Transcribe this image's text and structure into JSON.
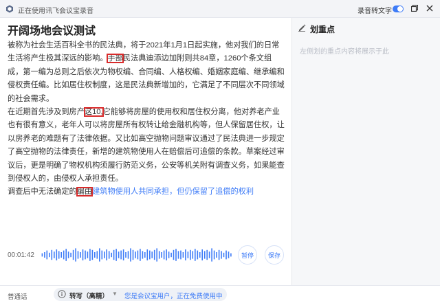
{
  "titlebar": {
    "title": "正在使用讯飞会议宝录音",
    "toggle_label": "录音转文字",
    "toggle_on": true
  },
  "document": {
    "title": "开阔场地会议测试",
    "paragraphs": [
      {
        "segments": [
          {
            "text": "被称为社会生活百科全书的民法典，将于2021年1月1日起实施，他对我们的日常生活将产生极其深远的影响。",
            "highlight": false
          },
          {
            "text": "手部",
            "highlight": true
          },
          {
            "text": "民法典迪添边加附则共84章，1260个条文组成，第一编为总则之后依次为物权编、合同编、人格权编、婚姻家庭编、继承编和侵权责任编。比如居住权制度，这是民法典新增加的，它满足了不同层次不同领域的社会需求。",
            "highlight": false
          }
        ]
      },
      {
        "segments": [
          {
            "text": "在近期首先涉及到房产",
            "highlight": false
          },
          {
            "text": "这10,",
            "highlight": true
          },
          {
            "text": "它能够将房屋的使用权和居住权分离，他对养老产业也有很有意义，老年人可以将房屋所有权转让给金融机构等，但人保留居住权，让以房养老的难题有了法律依据。又比如高空抛物问题审议通过了民法典进一步规定了高空抛物的法律责任，新增的建筑物使用人在赔偿后可追偿的条款。草案经过审议后，更是明确了物权机构须履行防范义务，公安等机关附有调查义务，如果能查到侵权人的，由侵权人承担责任。",
            "highlight": false
          }
        ]
      },
      {
        "segments": [
          {
            "text": "调查后中无法确定的",
            "highlight": false
          },
          {
            "text": "编由",
            "highlight": true
          },
          {
            "text": "建筑物使用人共同承担，但仍保留了追偿的权利",
            "highlight": false,
            "live": true
          }
        ]
      }
    ]
  },
  "notes_panel": {
    "title": "划重点",
    "hint": "左侧划的重点内容将展示于此"
  },
  "recording": {
    "elapsed": "00:01:42",
    "pause_label": "暂停",
    "save_label": "保存",
    "wave_levels": [
      3,
      5,
      8,
      4,
      9,
      6,
      10,
      7,
      5,
      8,
      11,
      6,
      4,
      9,
      12,
      7,
      5,
      10,
      8,
      6,
      11,
      9,
      5,
      7,
      12,
      8,
      6,
      10,
      7,
      4,
      9,
      11,
      6,
      8,
      10,
      5,
      7,
      12,
      9,
      6,
      8,
      11,
      7,
      5,
      10,
      8,
      6,
      9,
      12,
      7,
      5,
      8,
      10,
      6,
      4,
      9,
      11,
      7,
      8,
      5,
      10,
      6,
      9,
      7,
      11,
      8,
      5,
      10,
      7,
      9,
      6,
      12,
      8,
      5,
      9,
      7,
      4,
      8,
      6,
      3
    ]
  },
  "footer": {
    "mode": "普通话",
    "transcribe_mode": "转写（高精）",
    "user_note": "您是会议宝用户，正在免费使用中"
  },
  "colors": {
    "accent": "#3d7bf7",
    "highlight_box": "#d92b2b"
  }
}
